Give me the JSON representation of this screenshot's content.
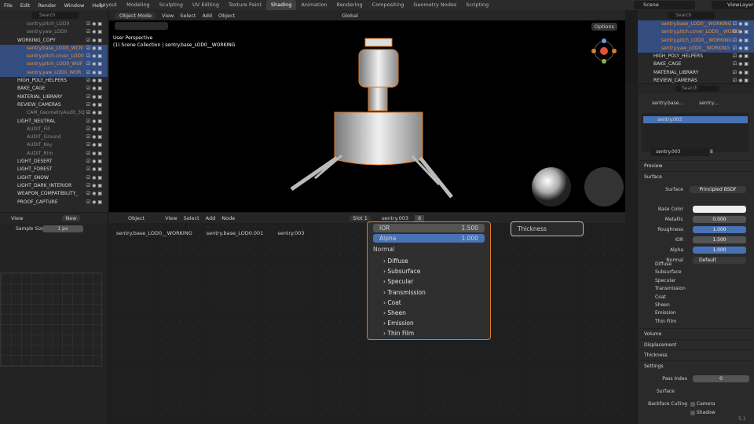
{
  "menu": [
    "File",
    "Edit",
    "Render",
    "Window",
    "Help"
  ],
  "workspaces": [
    "Layout",
    "Modeling",
    "Sculpting",
    "UV Editing",
    "Texture Paint",
    "Shading",
    "Animation",
    "Rendering",
    "Compositing",
    "Geometry Nodes",
    "Scripting"
  ],
  "active_workspace": "Shading",
  "scene": "Scene",
  "view_layer": "ViewLayer",
  "search_ph": "Search",
  "outliner": [
    {
      "t": "sentry.pitch_LOD0",
      "c": "dim",
      "s": false
    },
    {
      "t": "sentry.yaw_LOD0",
      "c": "dim",
      "s": false
    },
    {
      "t": "WORKING_COPY",
      "c": "",
      "s": false
    },
    {
      "t": "sentry.base_LOD0_WCN",
      "c": "orange",
      "s": true
    },
    {
      "t": "sentry.pitch.cover_LOD0",
      "c": "orange",
      "s": true
    },
    {
      "t": "sentry.pitch_LOD0_WOF",
      "c": "orange",
      "s": true
    },
    {
      "t": "sentry.yaw_LOD0_WOR",
      "c": "orange",
      "s": true
    },
    {
      "t": "HIGH_POLY_HELPERS",
      "c": "",
      "s": false
    },
    {
      "t": "BAKE_CAGE",
      "c": "",
      "s": false
    },
    {
      "t": "MATERIAL_LIBRARY",
      "c": "",
      "s": false
    },
    {
      "t": "REVIEW_CAMERAS",
      "c": "",
      "s": false
    },
    {
      "t": "CAM_GeometryAudit_3Q",
      "c": "dim",
      "s": false
    },
    {
      "t": "LIGHT_NEUTRAL",
      "c": "",
      "s": false
    },
    {
      "t": "AUDIT_Fill",
      "c": "dim",
      "s": false
    },
    {
      "t": "AUDIT_Ground",
      "c": "dim",
      "s": false
    },
    {
      "t": "AUDIT_Key",
      "c": "dim",
      "s": false
    },
    {
      "t": "AUDIT_Rim",
      "c": "dim",
      "s": false
    },
    {
      "t": "LIGHT_DESERT",
      "c": "",
      "s": false
    },
    {
      "t": "LIGHT_FOREST",
      "c": "",
      "s": false
    },
    {
      "t": "LIGHT_SNOW",
      "c": "",
      "s": false
    },
    {
      "t": "LIGHT_DARK_INTERIOR",
      "c": "",
      "s": false
    },
    {
      "t": "WEAPON_COMPATIBILITY_",
      "c": "",
      "s": false
    },
    {
      "t": "PROOF_CAPTURE",
      "c": "",
      "s": false
    }
  ],
  "viewport": {
    "mode": "Object Mode",
    "menu": [
      "View",
      "Select",
      "Add",
      "Object"
    ],
    "orient": "Global",
    "perspective": "User Perspective",
    "collection": "(1) Scene Collection | sentry.base_LOD0__WORKING",
    "options": "Options"
  },
  "node_editor": {
    "type": "Object",
    "menu": [
      "View",
      "Select",
      "Add",
      "Node"
    ],
    "slot": "Slot 1",
    "material": "sentry.003",
    "users": "8",
    "breadcrumb": [
      "sentry.base_LOD0__WORKING",
      "sentry.base_LOD0.001",
      "sentry.003"
    ],
    "ior_label": "IOR",
    "ior": "1.500",
    "alpha_label": "Alpha",
    "alpha": "1.000",
    "normal": "Normal",
    "panels": [
      "Diffuse",
      "Subsurface",
      "Specular",
      "Transmission",
      "Coat",
      "Sheen",
      "Emission",
      "Thin Film"
    ],
    "thickness": "Thickness"
  },
  "left_panel": {
    "view": "View",
    "new": "New",
    "sample_label": "Sample Size",
    "sample": "1 px"
  },
  "outliner_right": [
    {
      "t": "sentry.base_LOD0__WORKING",
      "o": true
    },
    {
      "t": "sentry.pitch.cover_LOD0__WORKI",
      "o": true
    },
    {
      "t": "sentry.pitch_LOD0__WORKING",
      "o": true
    },
    {
      "t": "sentry.yaw_LOD0__WORKING",
      "o": true
    },
    {
      "t": "HIGH_POLY_HELPERS",
      "o": false
    },
    {
      "t": "BAKE_CAGE",
      "o": false
    },
    {
      "t": "MATERIAL_LIBRARY",
      "o": false
    },
    {
      "t": "REVIEW_CAMERAS",
      "o": false
    }
  ],
  "properties": {
    "crumb1": "sentry.base...",
    "crumb2": "sentry....",
    "slot_item": "sentry.003",
    "mat": "sentry.003",
    "users": "8",
    "preview": "Preview",
    "surface": "Surface",
    "surface_label": "Surface",
    "surface_val": "Principled BSDF",
    "fields": [
      {
        "l": "Base Color",
        "v": "",
        "type": "color"
      },
      {
        "l": "Metallic",
        "v": "0.000",
        "type": "grey"
      },
      {
        "l": "Roughness",
        "v": "1.000",
        "type": "blue"
      },
      {
        "l": "IOR",
        "v": "1.500",
        "type": "grey"
      },
      {
        "l": "Alpha",
        "v": "1.000",
        "type": "blue"
      },
      {
        "l": "Normal",
        "v": "Default",
        "type": "dark"
      }
    ],
    "subs": [
      "Diffuse",
      "Subsurface",
      "Specular",
      "Transmission",
      "Coat",
      "Sheen",
      "Emission",
      "Thin Film"
    ],
    "volume": "Volume",
    "displacement": "Displacement",
    "thickness": "Thickness",
    "settings": "Settings",
    "pass_label": "Pass Index",
    "pass": "0",
    "surface2": "Surface",
    "backface": "Backface Culling",
    "camera": "Camera",
    "shadow": "Shadow"
  },
  "status": "5.1"
}
